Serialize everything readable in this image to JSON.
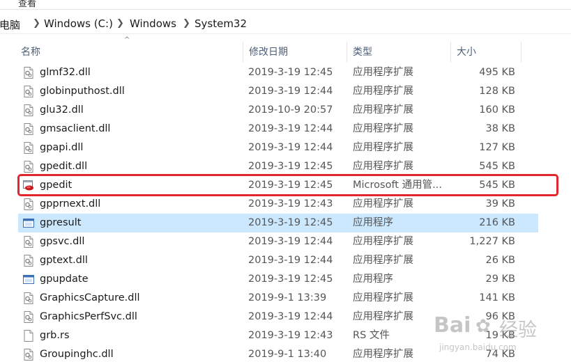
{
  "ribbon": {
    "view_tab": "查看"
  },
  "address": {
    "crumbs": [
      "此电脑",
      "Windows (C:)",
      "Windows",
      "System32"
    ]
  },
  "columns": {
    "name": "名称",
    "date": "修改日期",
    "type": "类型",
    "size": "大小"
  },
  "files": [
    {
      "name": "glmf32.dll",
      "date": "2019-3-19 12:45",
      "type": "应用程序扩展",
      "size": "495 KB",
      "icon": "dll-file-icon"
    },
    {
      "name": "globinputhost.dll",
      "date": "2019-3-19 12:44",
      "type": "应用程序扩展",
      "size": "128 KB",
      "icon": "dll-file-icon"
    },
    {
      "name": "glu32.dll",
      "date": "2019-10-9 20:57",
      "type": "应用程序扩展",
      "size": "160 KB",
      "icon": "dll-file-icon"
    },
    {
      "name": "gmsaclient.dll",
      "date": "2019-3-19 12:44",
      "type": "应用程序扩展",
      "size": "38 KB",
      "icon": "dll-file-icon"
    },
    {
      "name": "gpapi.dll",
      "date": "2019-3-19 12:44",
      "type": "应用程序扩展",
      "size": "127 KB",
      "icon": "dll-file-icon"
    },
    {
      "name": "gpedit.dll",
      "date": "2019-3-19 12:45",
      "type": "应用程序扩展",
      "size": "545 KB",
      "icon": "dll-file-icon"
    },
    {
      "name": "gpedit",
      "date": "2019-3-19 12:45",
      "type": "Microsoft 通用管...",
      "size": "545 KB",
      "icon": "msc-console-icon"
    },
    {
      "name": "gpprnext.dll",
      "date": "2019-3-19 12:43",
      "type": "应用程序扩展",
      "size": "39 KB",
      "icon": "dll-file-icon"
    },
    {
      "name": "gpresult",
      "date": "2019-3-19 12:45",
      "type": "应用程序",
      "size": "216 KB",
      "icon": "exe-app-icon",
      "selected": true
    },
    {
      "name": "gpsvc.dll",
      "date": "2019-3-19 12:44",
      "type": "应用程序扩展",
      "size": "1,227 KB",
      "icon": "dll-file-icon"
    },
    {
      "name": "gptext.dll",
      "date": "2019-3-19 12:44",
      "type": "应用程序扩展",
      "size": "26 KB",
      "icon": "dll-file-icon"
    },
    {
      "name": "gpupdate",
      "date": "2019-3-19 12:45",
      "type": "应用程序",
      "size": "29 KB",
      "icon": "exe-app-icon"
    },
    {
      "name": "GraphicsCapture.dll",
      "date": "2019-9-1 13:39",
      "type": "应用程序扩展",
      "size": "141 KB",
      "icon": "dll-file-icon"
    },
    {
      "name": "GraphicsPerfSvc.dll",
      "date": "2019-3-19 12:44",
      "type": "应用程序扩展",
      "size": "96 KB",
      "icon": "dll-file-icon"
    },
    {
      "name": "grb.rs",
      "date": "2019-3-19 12:43",
      "type": "RS 文件",
      "size": "19 KB",
      "icon": "blank-file-icon"
    },
    {
      "name": "Groupinghc.dll",
      "date": "2019-9-1 13:40",
      "type": "应用程序扩展",
      "size": "74 KB",
      "icon": "dll-file-icon"
    }
  ],
  "watermark": {
    "brand": "Bai",
    "brand2": "经验",
    "site": "jingyan.baidu.com"
  },
  "colors": {
    "selection": "#cce8ff",
    "highlight_box": "#e3262b",
    "header_text": "#4c607a"
  }
}
